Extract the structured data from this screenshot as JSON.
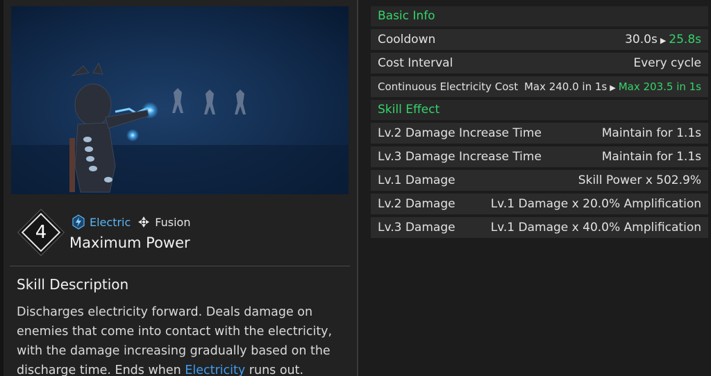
{
  "skill": {
    "number": "4",
    "tags": [
      {
        "label": "Electric",
        "icon": "lightning-icon",
        "color": "#5ab6f5"
      },
      {
        "label": "Fusion",
        "icon": "fusion-icon",
        "color": "#e6e6e6"
      }
    ],
    "name": "Maximum Power"
  },
  "description": {
    "title": "Skill Description",
    "text_before": "Discharges electricity forward. Deals damage on enemies that come into contact with the electricity, with the damage increasing gradually based on the discharge time. Ends when ",
    "highlight": "Electricity",
    "text_after": " runs out."
  },
  "basic_info": {
    "title": "Basic Info",
    "cooldown": {
      "label": "Cooldown",
      "base": "30.0s",
      "boosted": "25.8s"
    },
    "cost_interval": {
      "label": "Cost Interval",
      "value": "Every cycle"
    },
    "electricity_cost": {
      "label": "Continuous Electricity Cost",
      "base": "Max 240.0 in 1s",
      "boosted": "Max 203.5 in 1s"
    }
  },
  "skill_effect": {
    "title": "Skill Effect",
    "rows": [
      {
        "label": "Lv.2 Damage Increase Time",
        "value": "Maintain for 1.1s"
      },
      {
        "label": "Lv.3 Damage Increase Time",
        "value": "Maintain for 1.1s"
      },
      {
        "label": "Lv.1 Damage",
        "value": "Skill Power x 502.9%"
      },
      {
        "label": "Lv.2 Damage",
        "value": "Lv.1 Damage x 20.0% Amplification"
      },
      {
        "label": "Lv.3 Damage",
        "value": "Lv.1 Damage x 40.0% Amplification"
      }
    ]
  },
  "colors": {
    "accent_green": "#35d46a",
    "electric_blue": "#5ab6f5",
    "link_blue": "#3f9cf0"
  }
}
